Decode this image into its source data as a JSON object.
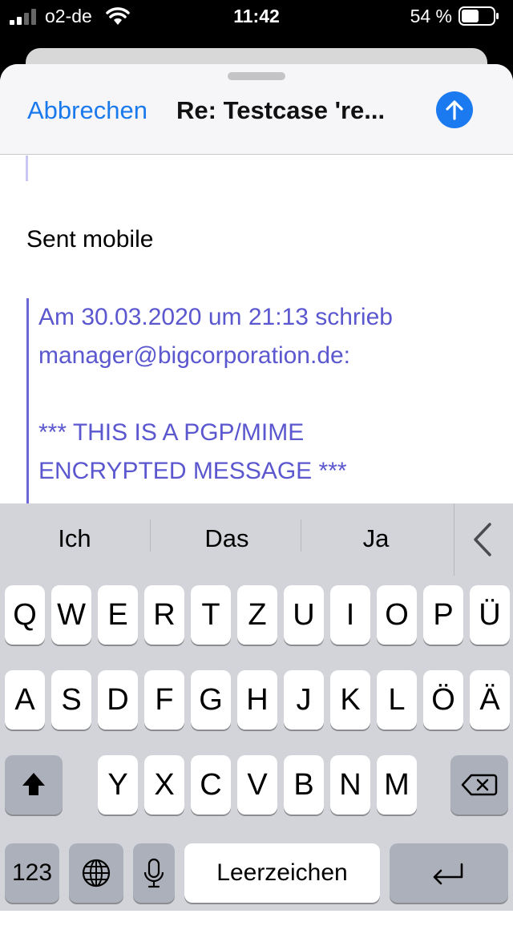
{
  "status": {
    "carrier": "o2-de",
    "time": "11:42",
    "battery_pct": "54 %",
    "battery_level": 0.54
  },
  "nav": {
    "cancel_label": "Abbrechen",
    "subject": "Re: Testcase 're...",
    "send_icon": "arrow-up-icon"
  },
  "message": {
    "body": "Sent mobile",
    "quote_header_1": "Am 30.03.2020 um 21:13 schrieb",
    "quote_header_2": "manager@bigcorporation.de:",
    "quote_line_1": "*** THIS IS A PGP/MIME",
    "quote_line_2": "ENCRYPTED MESSAGE ***"
  },
  "keyboard": {
    "predictions": [
      "Ich",
      "Das",
      "Ja"
    ],
    "row1": [
      "Q",
      "W",
      "E",
      "R",
      "T",
      "Z",
      "U",
      "I",
      "O",
      "P",
      "Ü"
    ],
    "row2": [
      "A",
      "S",
      "D",
      "F",
      "G",
      "H",
      "J",
      "K",
      "L",
      "Ö",
      "Ä"
    ],
    "row3": [
      "Y",
      "X",
      "C",
      "V",
      "B",
      "N",
      "M"
    ],
    "numbers_label": "123",
    "space_label": "Leerzeichen"
  },
  "colors": {
    "accent": "#1a7aed",
    "quote": "#5b57cf",
    "keyboard_bg": "#d2d4da"
  }
}
